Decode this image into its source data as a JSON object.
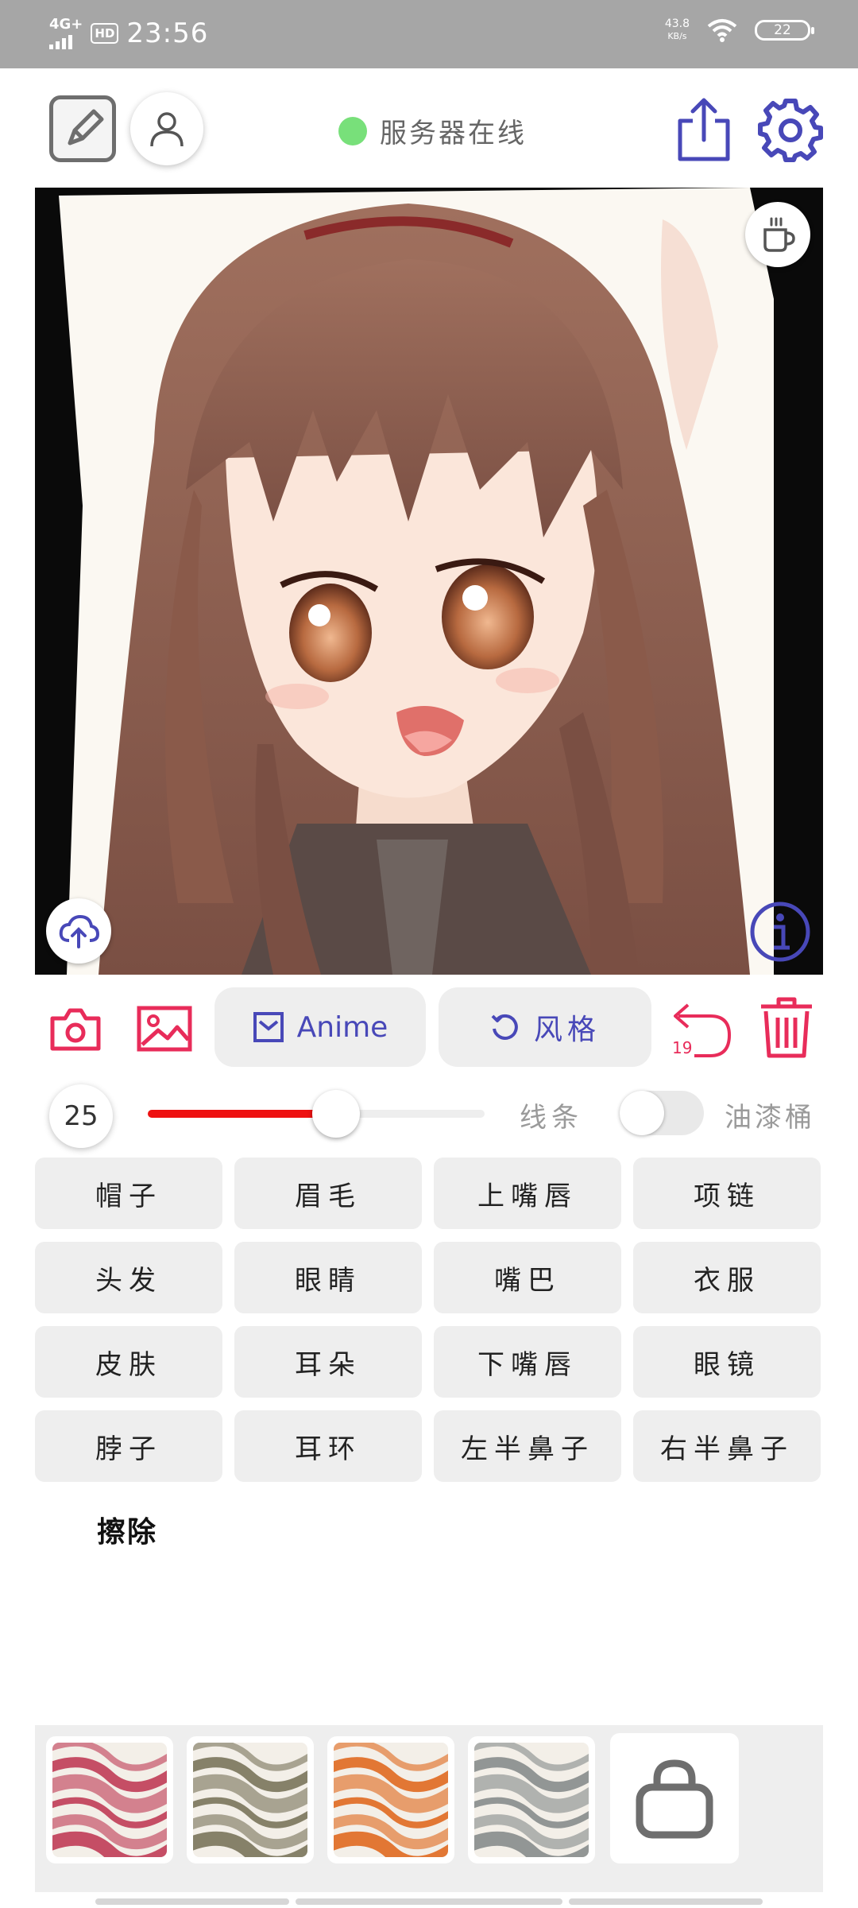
{
  "status_bar": {
    "network": "4G+",
    "hd": "HD",
    "time": "23:56",
    "speed_value": "43.8",
    "speed_unit": "KB/s",
    "battery": "22"
  },
  "toolbar": {
    "edit_icon": "draw-edit-icon",
    "user_icon": "user-icon",
    "server_status": "服务器在线",
    "server_status_color": "#78e07a",
    "share_icon": "share-icon",
    "settings_icon": "gear-icon"
  },
  "canvas": {
    "content": "anime-portrait-image",
    "coffee_icon": "coffee-icon",
    "upload_icon": "cloud-upload-icon",
    "info_icon": "info-icon"
  },
  "controls": {
    "camera_icon": "camera-icon",
    "gallery_icon": "image-icon",
    "anime_label": "Anime",
    "style_label": "风格",
    "undo_count": "19",
    "accent_color": "#e82c5a",
    "primary_color": "#4848b8"
  },
  "brush": {
    "size": "25",
    "slider_fraction": 0.56,
    "line_label": "线条",
    "bucket_label": "油漆桶",
    "bucket_enabled": false
  },
  "parts": [
    "帽子",
    "眉毛",
    "上嘴唇",
    "项链",
    "头发",
    "眼睛",
    "嘴巴",
    "衣服",
    "皮肤",
    "耳朵",
    "下嘴唇",
    "眼镜",
    "脖子",
    "耳环",
    "左半鼻子",
    "右半鼻子"
  ],
  "erase_label": "擦除",
  "textures": [
    {
      "name": "texture-swatch-red",
      "color": "#c2455e"
    },
    {
      "name": "texture-swatch-olive",
      "color": "#7f7a62"
    },
    {
      "name": "texture-swatch-orange",
      "color": "#e0702a"
    },
    {
      "name": "texture-swatch-gray",
      "color": "#8c9090"
    }
  ],
  "store_icon": "shopping-bag-icon"
}
